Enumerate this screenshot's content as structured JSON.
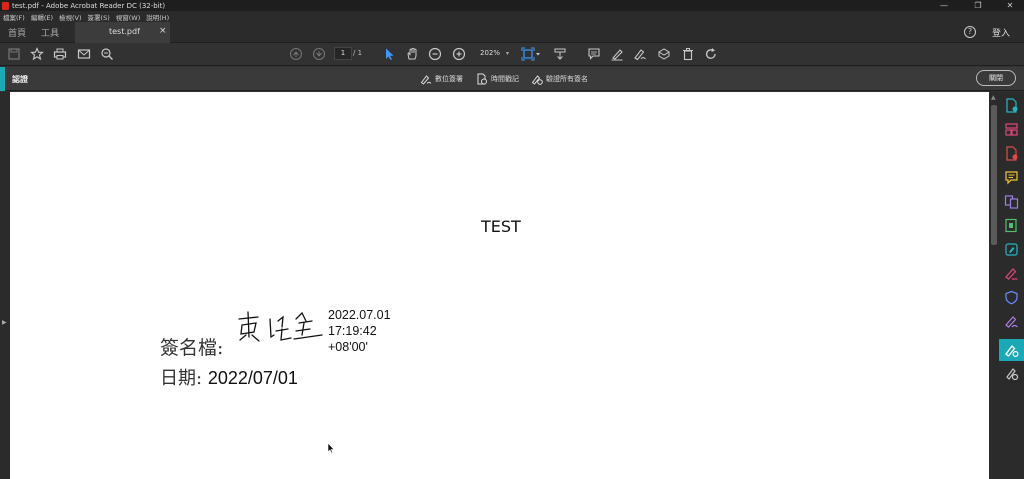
{
  "titlebar": {
    "title": "test.pdf - Adobe Acrobat Reader DC (32-bit)",
    "minimize": "—",
    "restore": "❐",
    "close": "✕"
  },
  "menu": [
    "檔案(F)",
    "編輯(E)",
    "檢視(V)",
    "簽署(S)",
    "視窗(W)",
    "說明(H)"
  ],
  "tabs": {
    "home": "首頁",
    "tools": "工具",
    "file": "test.pdf",
    "close": "×"
  },
  "account": {
    "login": "登入",
    "help": "?"
  },
  "toolbar": {
    "page_current": "1",
    "page_total": "/ 1",
    "zoom": "202%",
    "zoom_caret": "▾"
  },
  "certbar": {
    "title": "認證",
    "actions": [
      "數位簽署",
      "時間戳記",
      "驗證所有簽名"
    ],
    "close": "關閉"
  },
  "document": {
    "title": "TEST",
    "sign_label": "簽名檔:",
    "timestamp": [
      "2022.07.01",
      "17:19:42",
      "+08'00'"
    ],
    "date_label": "日期:",
    "date_value": "2022/07/01"
  },
  "colors": {
    "accent": "#1aa9b5",
    "background": "#323232",
    "page": "#ffffff"
  }
}
